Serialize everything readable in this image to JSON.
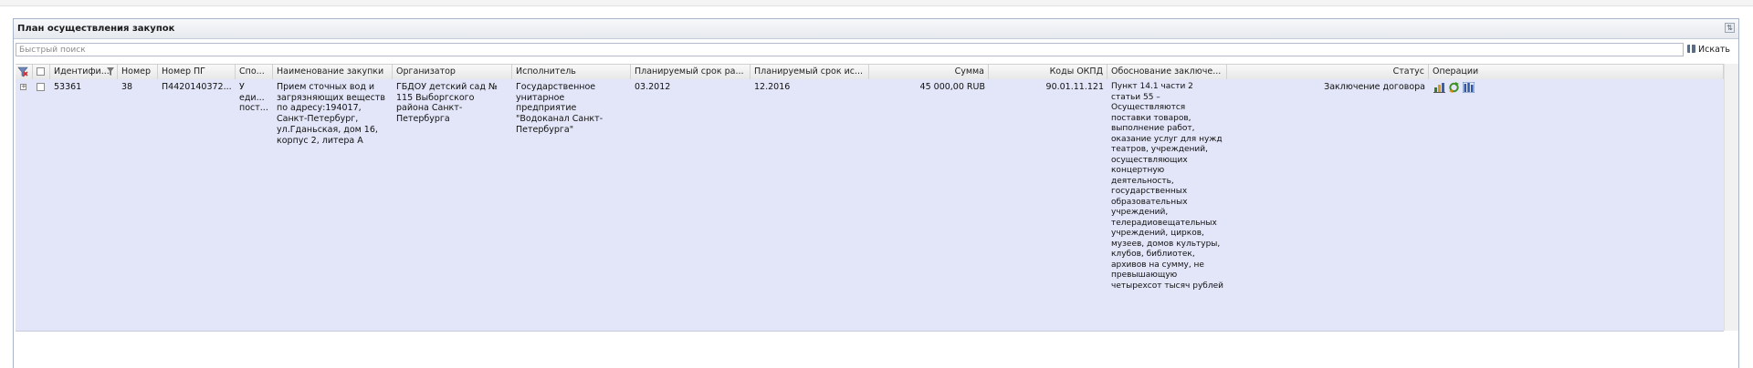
{
  "panel": {
    "title": "План осуществления закупок"
  },
  "search": {
    "placeholder": "Быстрый поиск",
    "button_label": "Искать"
  },
  "columns": [
    "Идентифи...",
    "Номер",
    "Номер ПГ",
    "Спо...",
    "Наименование закупки",
    "Организатор",
    "Исполнитель",
    "Планируемый срок ра...",
    "Планируемый срок ис...",
    "Сумма",
    "Коды ОКПД",
    "Обоснование заключе...",
    "Статус",
    "Операции"
  ],
  "rows": [
    {
      "id": "53361",
      "number": "38",
      "pg_number": "П4420140372...",
      "method": "У еди... пост...",
      "name": "Прием сточных вод и загрязняющих веществ по адресу:194017, Санкт-Петербург, ул.Гданьская, дом 16, корпус 2, литера А",
      "organizer": "ГБДОУ детский сад № 115 Выборгского района Санкт-Петербурга",
      "executor": "Государственное унитарное предприятие \"Водоканал Санкт-Петербурга\"",
      "plan_start": "03.2012",
      "plan_end": "12.2016",
      "amount": "45 000,00 RUB",
      "okpd": "90.01.11.121",
      "justification": "Пункт 14.1 части 2 статьи 55 – Осуществляются поставки товаров, выполнение работ, оказание услуг для нужд театров, учреждений, осуществляющих концертную деятельность, государственных образовательных учреждений, телерадиовещательных учреждений, цирков, музеев, домов культуры, клубов, библиотек, архивов на сумму, не превышающую четырехсот тысяч рублей",
      "status": "Заключение договора"
    }
  ],
  "icons": {
    "filter_clear": "filter-clear-icon",
    "sort": "sort-icon",
    "search": "binoculars-icon",
    "expand": "expand-icon",
    "ops": [
      "chart-icon",
      "refresh-icon",
      "columns-icon"
    ]
  },
  "colors": {
    "row_bg": "#e3e6f8",
    "header_border": "#a9b6c8"
  }
}
